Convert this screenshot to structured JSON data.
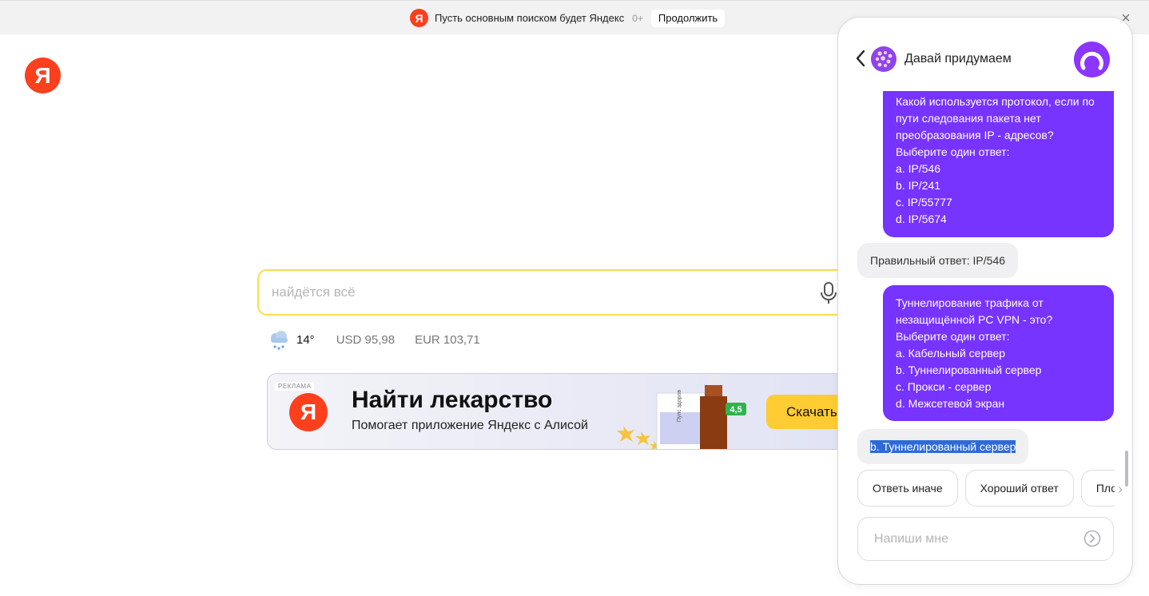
{
  "topbar": {
    "logo_letter": "Я",
    "text": "Пусть основным поиском будет Яндекс",
    "age": "0+",
    "continue_label": "Продолжить",
    "close_label": "×"
  },
  "logo": {
    "letter": "Я",
    "brand_color": "#fc3f1d"
  },
  "search": {
    "value": "",
    "placeholder": "найдётся всё",
    "border_color": "#ffdb4d"
  },
  "informers": {
    "temperature": "14°",
    "usd": "USD 95,98",
    "eur": "EUR 103,71"
  },
  "ad": {
    "label": "РЕКЛАМА",
    "logo_letter": "Я",
    "title": "Найти лекарство",
    "subtitle": "Помогает приложение Яндекс с Алисой",
    "button_label": "Скачать",
    "box_text": "Пупс здоров",
    "rating": "4,5",
    "accent_color": "#ffcc33"
  },
  "alice": {
    "skill_name": "Давай придумаем",
    "accent_color": "#7733ff",
    "messages": [
      {
        "from": "user",
        "text": "Какой используется протокол, если по\nпути следования пакета нет\nпреобразования IP - адресов?\nВыберите один ответ:\na. IP/546\nb. IP/241\nc. IP/55777\nd. IP/5674"
      },
      {
        "from": "alice",
        "text": "Правильный ответ: IP/546"
      },
      {
        "from": "user",
        "text": "Туннелирование трафика от\nнезащищённой PC VPN - это?\nВыберите один ответ:\na. Кабельный сервер\nb. Туннелированный сервер\nc. Прокси - сервер\nd. Межсетевой экран"
      },
      {
        "from": "alice",
        "text": "b. Туннелированный сервер"
      }
    ],
    "suggests": [
      "Ответь иначе",
      "Хороший ответ",
      "Плохой ответ"
    ],
    "input_placeholder": "Напиши мне"
  }
}
